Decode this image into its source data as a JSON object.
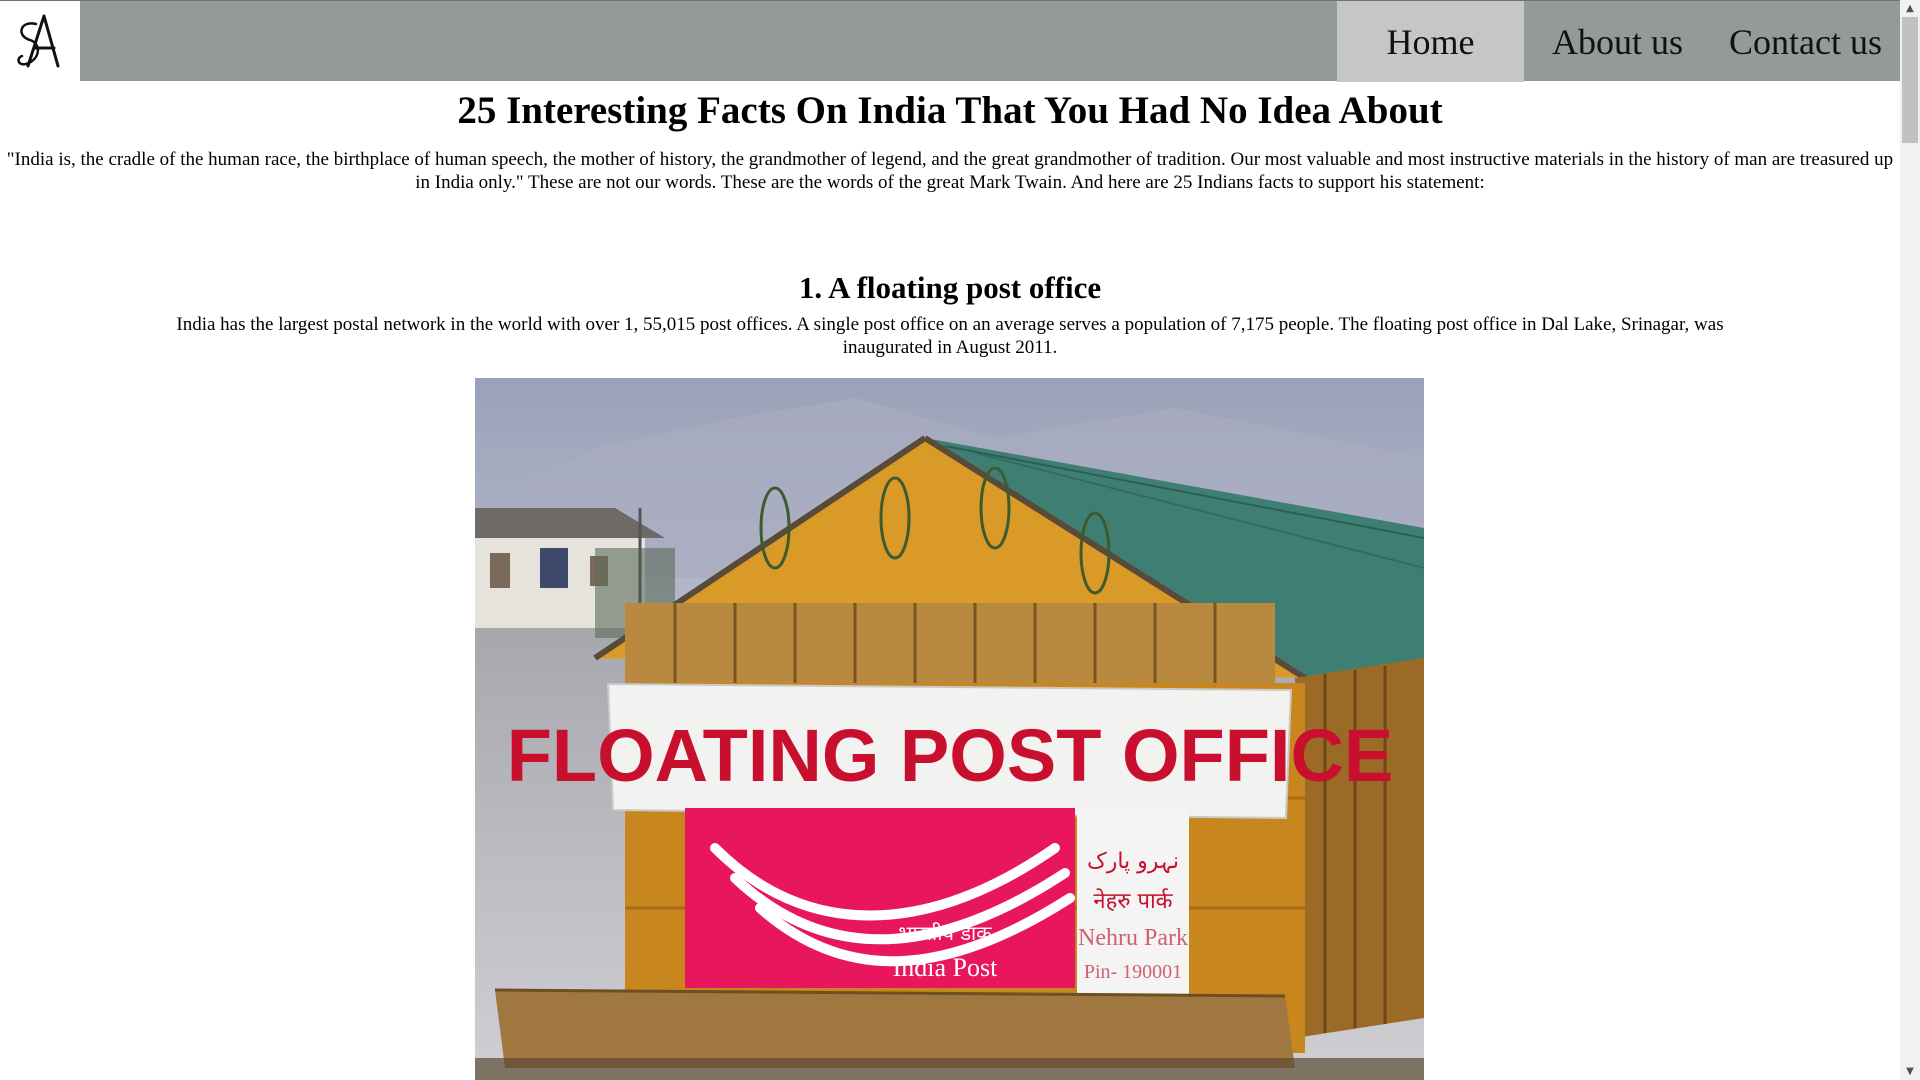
{
  "nav": {
    "logo_text": "A",
    "links": [
      {
        "label": "Home",
        "active": true
      },
      {
        "label": "About us",
        "active": false
      },
      {
        "label": "Contact us",
        "active": false
      }
    ]
  },
  "article": {
    "title": "25 Interesting Facts On India That You Had No Idea About",
    "intro": "\"India is, the cradle of the human race, the birthplace of human speech, the mother of history, the grandmother of legend, and the great grandmother of tradition. Our most valuable and most instructive materials in the history of man are treasured up in India only.\" These are not our words. These are the words of the great Mark Twain. And here are 25 Indians facts to support his statement:",
    "facts": [
      {
        "heading": "1. A floating post office",
        "text": "India has the largest postal network in the world with over 1, 55,015 post offices. A single post office on an average serves a population of 7,175 people. The floating post office in Dal Lake, Srinagar, was inaugurated in August 2011.",
        "image": {
          "sign_text": "FLOATING POST OFFICE",
          "hindi_label": "भारतीय डाक",
          "brand_label": "India Post",
          "urdu_label": "نہرو پارک",
          "hindi_place": "नेहरु पार्क",
          "place_label": "Nehru Park",
          "pin_label": "Pin- 190001"
        }
      }
    ]
  },
  "colors": {
    "navbar_bg": "#949a96",
    "active_nav_bg": "#c4c7c5",
    "sign_red": "#c8102e",
    "post_pink": "#e8175d",
    "roof_green": "#3f7f73",
    "wood": "#c8861f"
  },
  "icons": {
    "scroll_up": "▲",
    "scroll_down": "▼"
  }
}
